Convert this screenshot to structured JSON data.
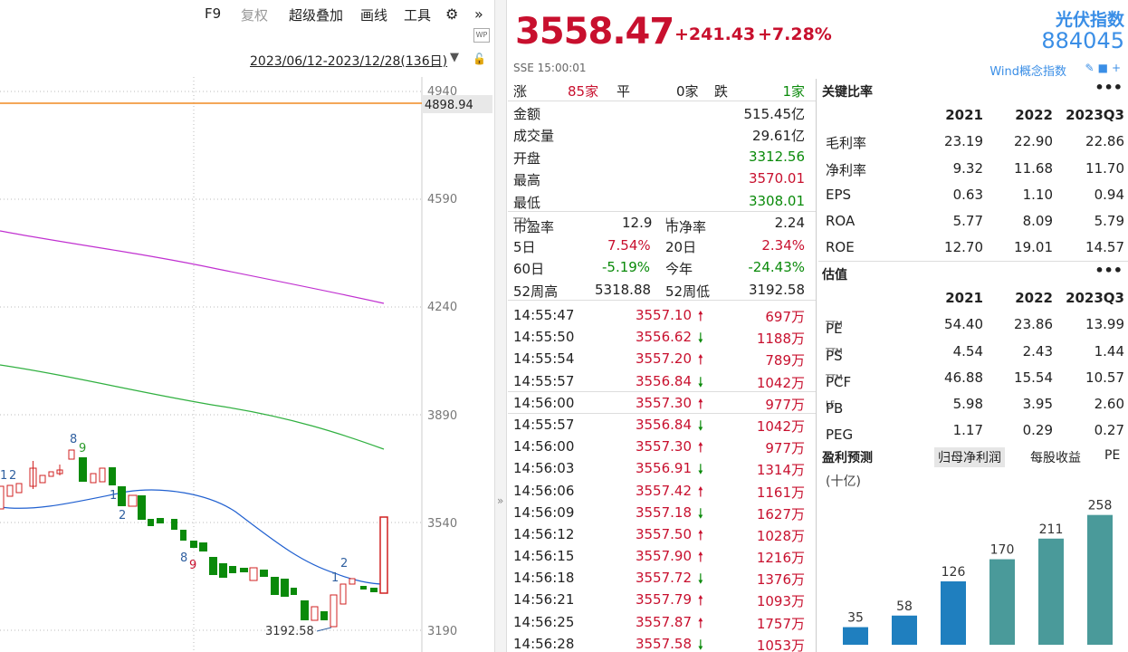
{
  "toolbar": {
    "f9": "F9",
    "fuquan": "复权",
    "overlay": "超级叠加",
    "draw": "画线",
    "tools": "工具",
    "wp": "WP",
    "date_range": "2023/06/12-2023/12/28(136日)"
  },
  "kline": {
    "price_axis": [
      "4940",
      "4590",
      "4240",
      "3890",
      "3540",
      "3190"
    ],
    "high_marker": "4898.94",
    "low_marker": "3192.58",
    "annotations": [
      "8",
      "9",
      "1",
      "2",
      "1",
      "2",
      "8",
      "9",
      "1",
      "2"
    ]
  },
  "header": {
    "price": "3558.47",
    "change": "+241.43",
    "change_pct": "+7.28%",
    "exchange_time": "SSE  15:00:01",
    "index_name": "光伏指数",
    "index_code": "884045",
    "tag": "Wind概念指数"
  },
  "quote": {
    "breadth": {
      "up_label": "涨",
      "up": "85家",
      "flat_label": "平",
      "flat": "0家",
      "down_label": "跌",
      "down": "1家"
    },
    "rows": [
      {
        "label": "金额",
        "value": "515.45亿"
      },
      {
        "label": "成交量",
        "value": "29.61亿"
      },
      {
        "label": "开盘",
        "value": "3312.56"
      },
      {
        "label": "最高",
        "value": "3570.01"
      },
      {
        "label": "最低",
        "value": "3308.01"
      }
    ],
    "pe_label": "市盈率",
    "pe_sup": "TTM",
    "pe": "12.9",
    "pb_label": "市净率",
    "pb_sup": "LF",
    "pb": "2.24",
    "d5_label": "5日",
    "d5": "7.54%",
    "d20_label": "20日",
    "d20": "2.34%",
    "d60_label": "60日",
    "d60": "-5.19%",
    "ytd_label": "今年",
    "ytd": "-24.43%",
    "w52h_label": "52周高",
    "w52h": "5318.88",
    "w52l_label": "52周低",
    "w52l": "3192.58"
  },
  "ticks": [
    {
      "time": "14:55:47",
      "price": "3557.10",
      "dir": "up",
      "vol": "697万"
    },
    {
      "time": "14:55:50",
      "price": "3556.62",
      "dir": "down",
      "vol": "1188万"
    },
    {
      "time": "14:55:54",
      "price": "3557.20",
      "dir": "up",
      "vol": "789万"
    },
    {
      "time": "14:55:57",
      "price": "3556.84",
      "dir": "down",
      "vol": "1042万"
    },
    {
      "time": "14:56:00",
      "price": "3557.30",
      "dir": "up",
      "vol": "977万"
    },
    {
      "time": "14:55:57",
      "price": "3556.84",
      "dir": "down",
      "vol": "1042万"
    },
    {
      "time": "14:56:00",
      "price": "3557.30",
      "dir": "up",
      "vol": "977万"
    },
    {
      "time": "14:56:03",
      "price": "3556.91",
      "dir": "down",
      "vol": "1314万"
    },
    {
      "time": "14:56:06",
      "price": "3557.42",
      "dir": "up",
      "vol": "1161万"
    },
    {
      "time": "14:56:09",
      "price": "3557.18",
      "dir": "down",
      "vol": "1627万"
    },
    {
      "time": "14:56:12",
      "price": "3557.50",
      "dir": "up",
      "vol": "1028万"
    },
    {
      "time": "14:56:15",
      "price": "3557.90",
      "dir": "up",
      "vol": "1216万"
    },
    {
      "time": "14:56:18",
      "price": "3557.72",
      "dir": "down",
      "vol": "1376万"
    },
    {
      "time": "14:56:21",
      "price": "3557.79",
      "dir": "up",
      "vol": "1093万"
    },
    {
      "time": "14:56:25",
      "price": "3557.87",
      "dir": "up",
      "vol": "1757万"
    },
    {
      "time": "14:56:28",
      "price": "3557.58",
      "dir": "down",
      "vol": "1053万"
    }
  ],
  "ratios": {
    "title": "关键比率",
    "more": "•••",
    "years": [
      "2021",
      "2022",
      "2023Q3"
    ],
    "rows": [
      {
        "label": "毛利率",
        "v": [
          "23.19",
          "22.90",
          "22.86"
        ]
      },
      {
        "label": "净利率",
        "v": [
          "9.32",
          "11.68",
          "11.70"
        ]
      },
      {
        "label": "EPS",
        "v": [
          "0.63",
          "1.10",
          "0.94"
        ]
      },
      {
        "label": "ROA",
        "v": [
          "5.77",
          "8.09",
          "5.79"
        ]
      },
      {
        "label": "ROE",
        "v": [
          "12.70",
          "19.01",
          "14.57"
        ]
      }
    ]
  },
  "valuation": {
    "title": "估值",
    "more": "•••",
    "years": [
      "2021",
      "2022",
      "2023Q3"
    ],
    "rows": [
      {
        "label": "PE",
        "sup": "TTM",
        "v": [
          "54.40",
          "23.86",
          "13.99"
        ]
      },
      {
        "label": "PS",
        "sup": "TTM",
        "v": [
          "4.54",
          "2.43",
          "1.44"
        ]
      },
      {
        "label": "PCF",
        "sup": "TTM",
        "v": [
          "46.88",
          "15.54",
          "10.57"
        ]
      },
      {
        "label": "PB",
        "sup": "LF",
        "v": [
          "5.98",
          "3.95",
          "2.60"
        ]
      },
      {
        "label": "PEG",
        "sup": "",
        "v": [
          "1.17",
          "0.29",
          "0.27"
        ]
      }
    ]
  },
  "forecast": {
    "title": "盈利预测",
    "tabs": [
      "归母净利润",
      "每股收益",
      "PE"
    ],
    "unit": "(十亿)"
  },
  "chart_data": {
    "type": "bar",
    "values": [
      35,
      58,
      126,
      170,
      211,
      258
    ],
    "colors": [
      "#1f7fbf",
      "#1f7fbf",
      "#1f7fbf",
      "#4a9a9a",
      "#4a9a9a",
      "#4a9a9a"
    ]
  },
  "colors": {
    "up": "#c8102e",
    "down": "#0a8a0a",
    "accent": "#3a8ee6"
  }
}
